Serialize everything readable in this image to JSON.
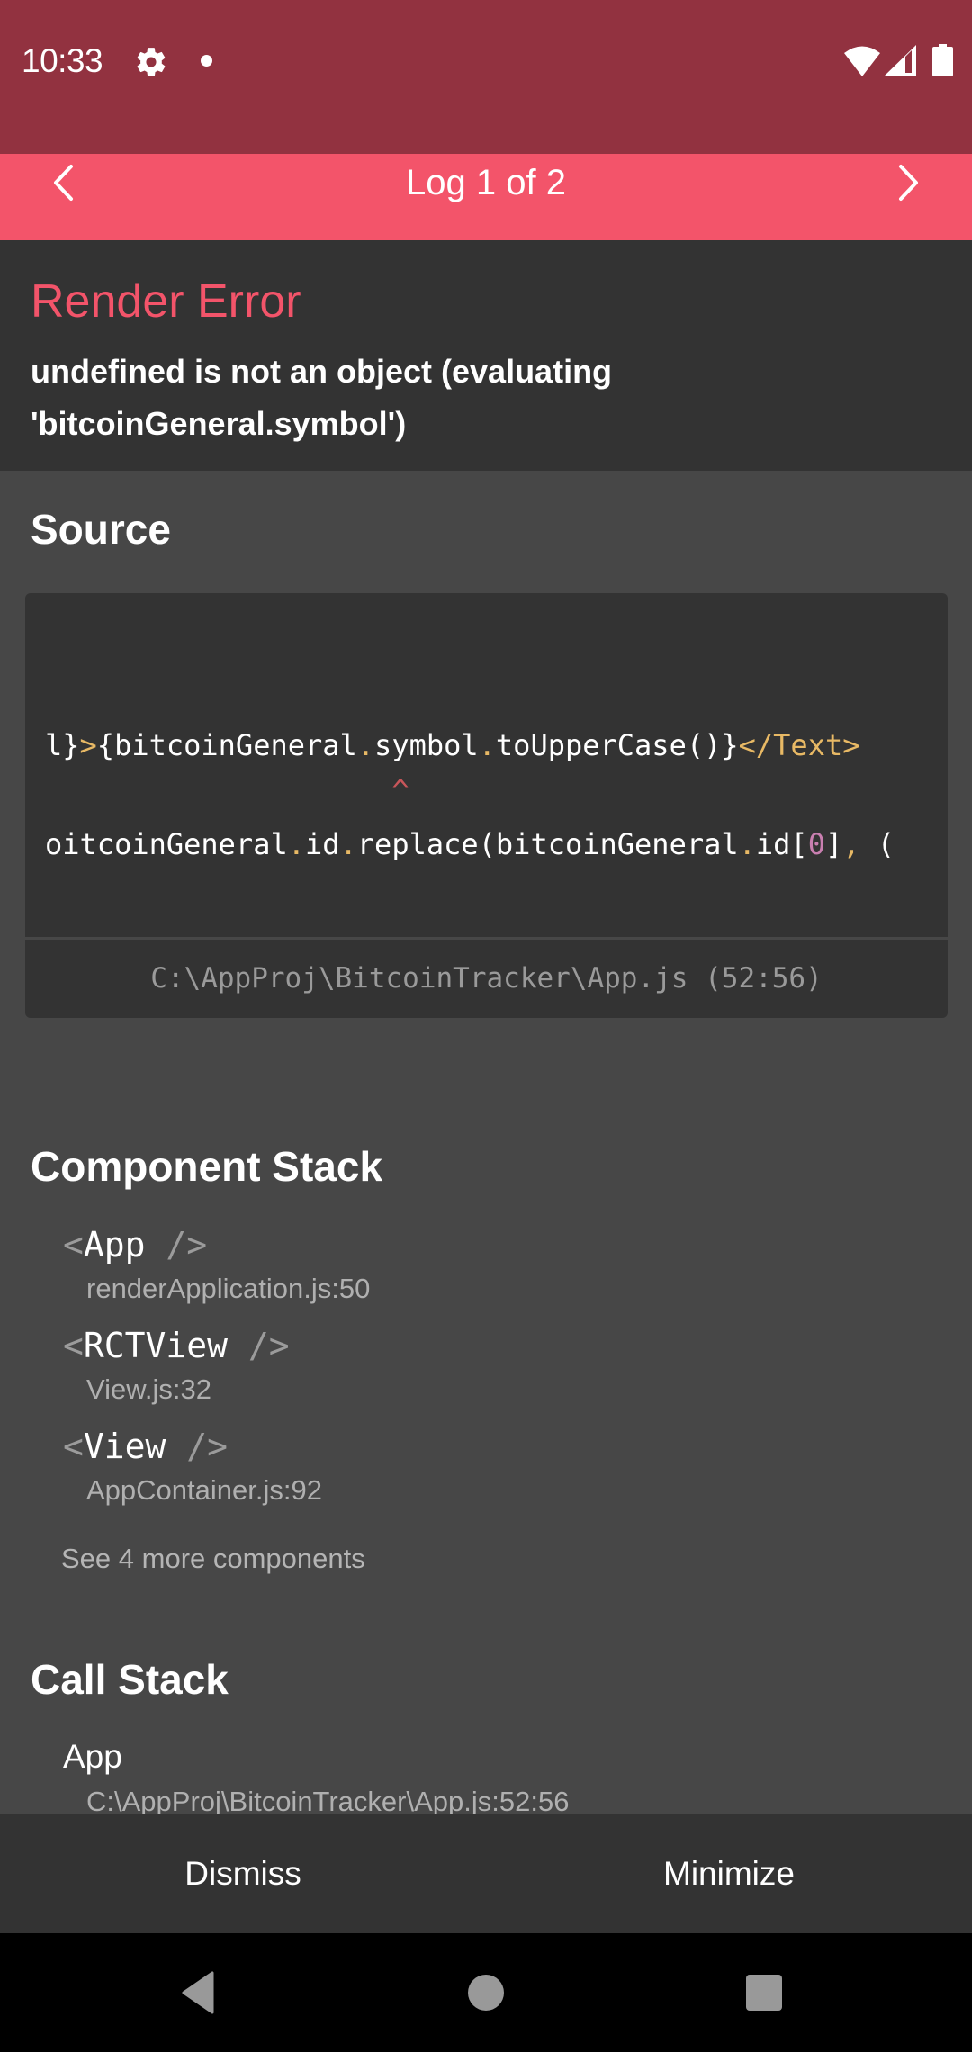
{
  "status_bar": {
    "time": "10:33",
    "icons": [
      "gear-icon",
      "notification-dot",
      "wifi-icon",
      "signal-icon",
      "battery-icon"
    ],
    "background": "#923240"
  },
  "log_nav": {
    "title": "Log 1 of 2",
    "prev_icon": "chevron-left-icon",
    "next_icon": "chevron-right-icon",
    "background": "#f3546a"
  },
  "error": {
    "type": "Render Error",
    "message": "undefined is not an object (evaluating 'bitcoinGeneral.symbol')",
    "accent": "#f3546a"
  },
  "source": {
    "title": "Source",
    "lines": [
      {
        "tokens": [
          {
            "text": "l}",
            "kind": "plain"
          },
          {
            "text": ">",
            "kind": "punct"
          },
          {
            "text": "{bitcoinGeneral",
            "kind": "plain"
          },
          {
            "text": ".",
            "kind": "punct"
          },
          {
            "text": "symbol",
            "kind": "plain"
          },
          {
            "text": ".",
            "kind": "punct"
          },
          {
            "text": "toUpperCase()}",
            "kind": "plain"
          },
          {
            "text": "</Text>",
            "kind": "punct"
          }
        ]
      },
      {
        "tokens": [
          {
            "text": "                    ^",
            "kind": "caret"
          }
        ]
      },
      {
        "tokens": [
          {
            "text": "oitcoinGeneral",
            "kind": "plain"
          },
          {
            "text": ".",
            "kind": "punct"
          },
          {
            "text": "id",
            "kind": "plain"
          },
          {
            "text": ".",
            "kind": "punct"
          },
          {
            "text": "replace(bitcoinGeneral",
            "kind": "plain"
          },
          {
            "text": ".",
            "kind": "punct"
          },
          {
            "text": "id[",
            "kind": "plain"
          },
          {
            "text": "0",
            "kind": "num"
          },
          {
            "text": "]",
            "kind": "plain"
          },
          {
            "text": ",",
            "kind": "punct"
          },
          {
            "text": " (",
            "kind": "plain"
          }
        ]
      }
    ],
    "location": "C:\\AppProj\\BitcoinTracker\\App.js (52:56)",
    "colors": {
      "punct": "#e8b965",
      "num": "#c97fb0",
      "caret": "#c8565a"
    }
  },
  "component_stack": {
    "title": "Component Stack",
    "items": [
      {
        "open": "<",
        "name": "App",
        "close": " />",
        "file": "renderApplication.js:50"
      },
      {
        "open": "<",
        "name": "RCTView",
        "close": " />",
        "file": "View.js:32"
      },
      {
        "open": "<",
        "name": "View",
        "close": " />",
        "file": "AppContainer.js:92"
      }
    ],
    "see_more": "See 4 more components"
  },
  "call_stack": {
    "title": "Call Stack",
    "items": [
      {
        "name": "App",
        "file": "C:\\AppProj\\BitcoinTracker\\App.js:52:56"
      }
    ]
  },
  "footer": {
    "dismiss": "Dismiss",
    "minimize": "Minimize"
  },
  "nav_bar": {
    "buttons": [
      "back-icon",
      "home-icon",
      "recents-icon"
    ]
  }
}
